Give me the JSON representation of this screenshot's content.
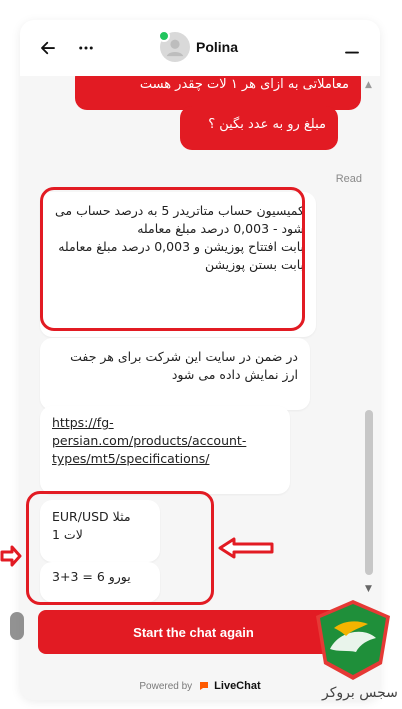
{
  "header": {
    "agent_name": "Polina"
  },
  "messages": {
    "out1": "معاملاتی به ازای هر ۱ لات چقدر هست",
    "out2": "مبلغ رو به عدد بگین ؟",
    "read_status": "Read",
    "in1": "کمیسیون حساب متاتریدر 5 به درصد حساب می شود - 0,003 درصد مبلغ معامله\nبابت افتتاح پوزیشن و 0,003 درصد مبلغ معامله\nبابت بستن پوزیشن",
    "in2": "در ضمن در سایت این شرکت برای هر جفت ارز نمایش داده می شود",
    "in3": "https://fg-persian.com/products/account-types/mt5/specifications/",
    "in4_line1": "EUR/USD مثلا",
    "in4_line2": "لات 1",
    "in5": "یورو 6 = 3+3"
  },
  "footer": {
    "cta_label": "Start the chat again",
    "powered_by": "Powered by",
    "brand": "LiveChat"
  },
  "watermark": {
    "text": "سجس بروکر"
  },
  "colors": {
    "accent": "#e21b23",
    "background": "#f6f6f6"
  },
  "icons": {
    "back": "arrow-left-icon",
    "more": "more-dots-icon",
    "minimize": "minimize-icon",
    "avatar": "avatar-icon",
    "livechat": "livechat-logo-icon"
  }
}
